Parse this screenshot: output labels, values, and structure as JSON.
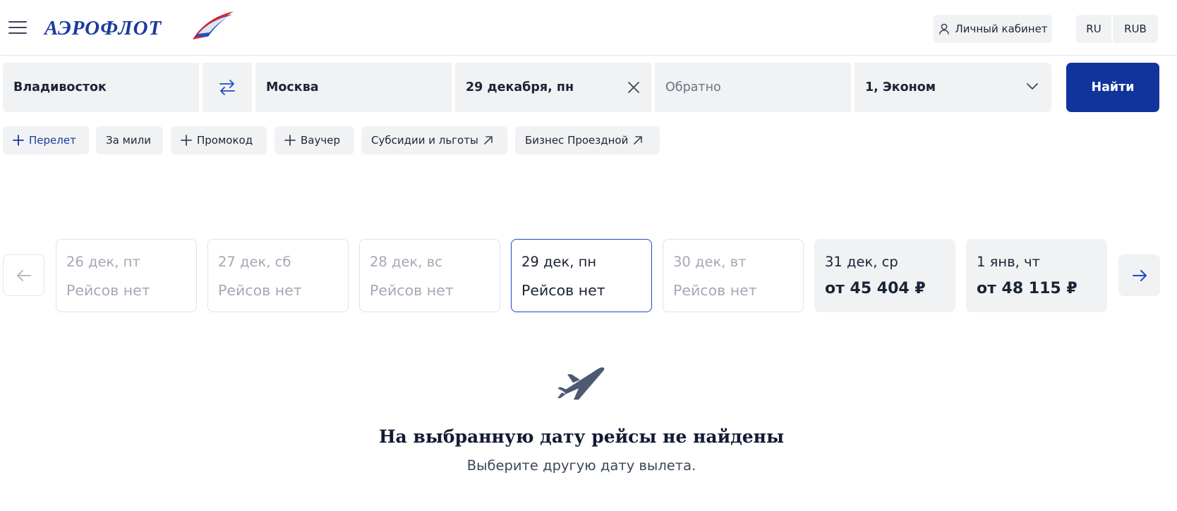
{
  "header": {
    "logo_text": "АЭРОФЛОТ",
    "account_label": "Личный кабинет",
    "language": "RU",
    "currency": "RUB"
  },
  "search": {
    "from": "Владивосток",
    "to": "Москва",
    "date": "29 декабря, пн",
    "return_placeholder": "Обратно",
    "passengers": "1, Эконом",
    "submit_label": "Найти"
  },
  "options": {
    "add_flight": "Перелет",
    "miles": "За мили",
    "promo": "Промокод",
    "voucher": "Ваучер",
    "subsidies": "Субсидии и льготы",
    "business_pass": "Бизнес Проездной"
  },
  "calendar": {
    "days": [
      {
        "date": "26 дек, пт",
        "info": "Рейсов нет"
      },
      {
        "date": "27 дек, сб",
        "info": "Рейсов нет"
      },
      {
        "date": "28 дек, вс",
        "info": "Рейсов нет"
      },
      {
        "date": "29 дек, пн",
        "info": "Рейсов нет"
      },
      {
        "date": "30 дек, вт",
        "info": "Рейсов нет"
      },
      {
        "date": "31 дек, ср",
        "info": "от 45 404 ₽"
      },
      {
        "date": "1 янв, чт",
        "info": "от 48 115 ₽"
      }
    ]
  },
  "empty_state": {
    "title": "На выбранную дату рейсы не найдены",
    "subtitle": "Выберите другую дату вылета."
  },
  "colors": {
    "brand": "#10339c",
    "accent": "#1e4bc3",
    "field_bg": "#f1f2f4",
    "muted": "#a3a9b4"
  },
  "icons": {
    "menu": "burger-menu-icon",
    "swap": "swap-arrows-icon",
    "clear": "close-icon",
    "dropdown": "chevron-down-icon",
    "plus": "plus-icon",
    "external": "arrow-up-right-icon",
    "prev": "arrow-left-icon",
    "next": "arrow-right-icon",
    "empty": "airplane-icon"
  }
}
